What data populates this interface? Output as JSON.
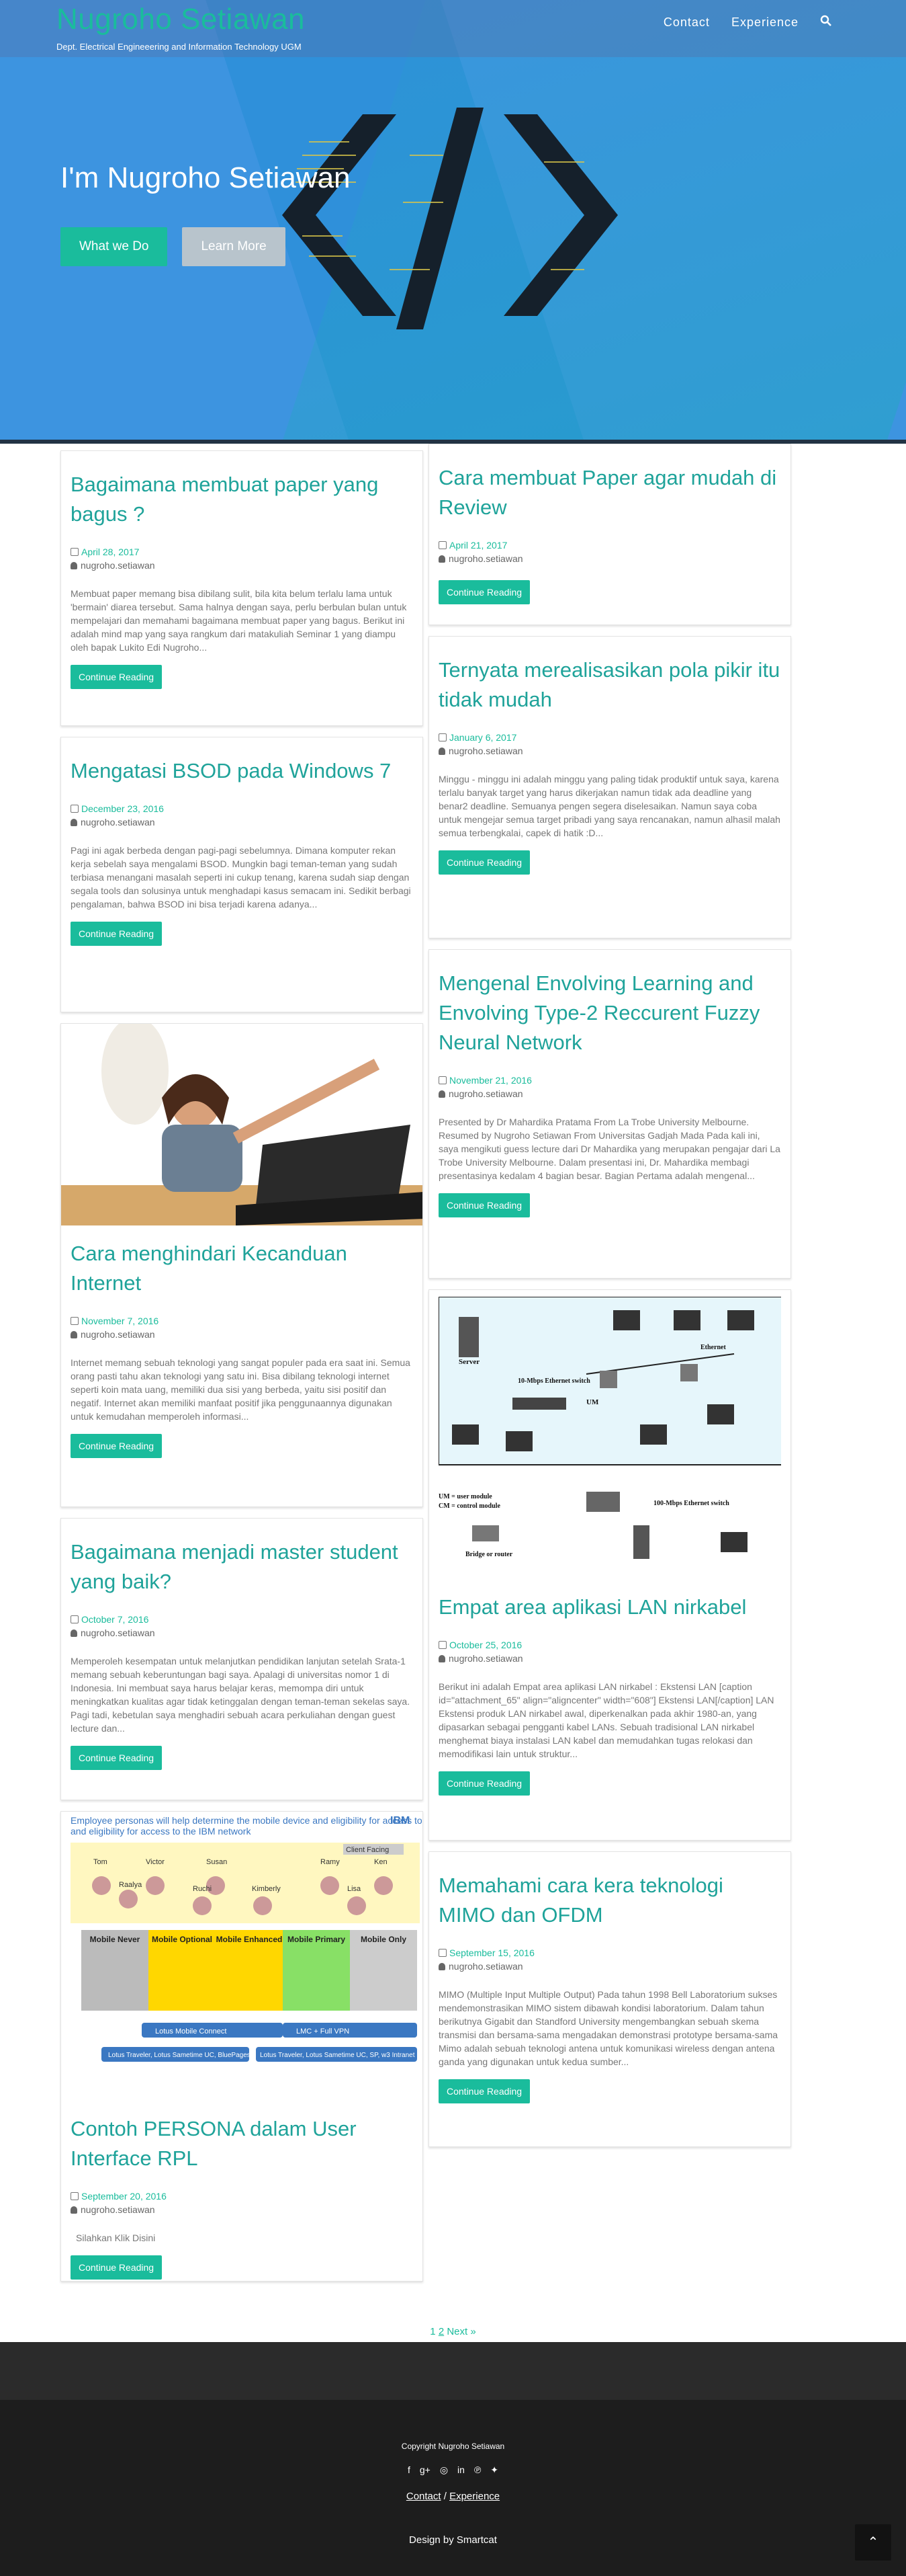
{
  "header": {
    "brand": "Nugroho Setiawan",
    "tagline": "Dept. Electrical Engineeering and Information Technology UGM",
    "nav": [
      "Contact",
      "Experience"
    ],
    "search_icon": "search-icon"
  },
  "hero": {
    "title": "I'm Nugroho Setiawan",
    "btn_primary": "What we Do",
    "btn_secondary": "Learn More"
  },
  "posts_left": [
    {
      "title": "Bagaimana membuat paper yang bagus ?",
      "date": "April 28, 2017",
      "author": "nugroho.setiawan",
      "excerpt": "Membuat paper memang bisa dibilang sulit, bila kita belum terlalu lama untuk 'bermain' diarea tersebut. Sama halnya dengan saya, perlu berbulan bulan untuk mempelajari dan memahami bagaimana membuat paper yang bagus. Berikut ini adalah mind map yang saya rangkum dari matakuliah Seminar 1 yang diampu oleh bapak Lukito Edi Nugroho...",
      "button": "Continue Reading"
    },
    {
      "title": "Mengatasi BSOD pada Windows 7",
      "date": "December 23, 2016",
      "author": "nugroho.setiawan",
      "excerpt": "Pagi ini agak berbeda dengan pagi-pagi sebelumnya. Dimana komputer rekan kerja sebelah saya mengalami BSOD. Mungkin bagi teman-teman yang sudah terbiasa menangani masalah seperti ini cukup tenang, karena sudah siap dengan segala tools dan solusinya untuk menghadapi kasus semacam ini. Sedikit berbagi pengalaman, bahwa BSOD ini bisa terjadi karena adanya...",
      "button": "Continue Reading"
    },
    {
      "title": "Cara menghindari Kecanduan Internet",
      "date": "November 7, 2016",
      "author": "nugroho.setiawan",
      "excerpt": "Internet memang sebuah teknologi yang sangat populer pada era saat ini. Semua orang pasti tahu akan teknologi yang satu ini. Bisa dibilang teknologi internet seperti koin mata uang, memiliki dua sisi yang berbeda, yaitu sisi positif dan negatif. Internet akan memiliki manfaat positif jika penggunaannya digunakan untuk kemudahan memperoleh informasi...",
      "button": "Continue Reading"
    },
    {
      "title": "Bagaimana menjadi master student yang baik?",
      "date": "October 7, 2016",
      "author": "nugroho.setiawan",
      "excerpt": "Memperoleh kesempatan untuk melanjutkan pendidikan lanjutan setelah Srata-1 memang sebuah keberuntungan bagi saya. Apalagi di universitas nomor 1 di Indonesia. Ini membuat saya harus belajar keras, memompa diri untuk meningkatkan kualitas agar tidak ketinggalan dengan teman-teman sekelas saya. Pagi tadi, kebetulan saya menghadiri sebuah acara perkuliahan dengan guest lecture dan...",
      "button": "Continue Reading"
    },
    {
      "title": "Contoh PERSONA dalam User Interface RPL",
      "date": "September 20, 2016",
      "author": "nugroho.setiawan",
      "excerpt": "Silahkan Klik Disini",
      "button": "Continue Reading"
    }
  ],
  "posts_right": [
    {
      "title": "Cara membuat Paper agar mudah di Review",
      "date": "April 21, 2017",
      "author": "nugroho.setiawan",
      "excerpt": "",
      "button": "Continue Reading"
    },
    {
      "title": "Ternyata merealisasikan pola pikir itu tidak mudah",
      "date": "January 6, 2017",
      "author": "nugroho.setiawan",
      "excerpt": "Minggu - minggu ini adalah minggu yang paling tidak produktif untuk saya, karena terlalu banyak target yang harus dikerjakan namun tidak ada deadline yang benar2 deadline. Semuanya pengen segera diselesaikan. Namun saya coba untuk mengejar semua target pribadi yang saya rencanakan, namun alhasil malah semua terbengkalai, capek di hatik :D...",
      "button": "Continue Reading"
    },
    {
      "title": "Mengenal Envolving Learning and Envolving Type-2 Reccurent Fuzzy Neural Network",
      "date": "November 21, 2016",
      "author": "nugroho.setiawan",
      "excerpt": "Presented by Dr Mahardika Pratama From La Trobe University Melbourne. Resumed by Nugroho Setiawan From Universitas Gadjah Mada Pada kali ini, saya mengikuti guess lecture dari Dr Mahardika yang merupakan pengajar dari La Trobe University Melbourne. Dalam presentasi ini, Dr. Mahardika membagi presentasinya kedalam 4 bagian besar. Bagian Pertama adalah mengenal...",
      "button": "Continue Reading"
    },
    {
      "title": "Empat area aplikasi LAN nirkabel",
      "date": "October 25, 2016",
      "author": "nugroho.setiawan",
      "excerpt": "Berikut ini adalah Empat area aplikasi LAN nirkabel : Ekstensi LAN [caption id=\"attachment_65\" align=\"aligncenter\" width=\"608\"] Ekstensi LAN[/caption] LAN Ekstensi produk LAN nirkabel awal, diperkenalkan pada akhir 1980-an, yang dipasarkan sebagai pengganti kabel LANs. Sebuah tradisional LAN nirkabel menghemat biaya instalasi LAN kabel dan memudahkan tugas relokasi dan memodifikasi lain untuk struktur...",
      "button": "Continue Reading"
    },
    {
      "title": "Memahami cara kera teknologi MIMO dan OFDM",
      "date": "September 15, 2016",
      "author": "nugroho.setiawan",
      "excerpt": "MIMO (Multiple Input Multiple Output) Pada tahun 1998 Bell Laboratorium sukses mendemonstrasikan MIMO sistem dibawah kondisi laboratorium. Dalam tahun berikutnya Gigabit dan Standford University mengembangkan sebuah skema transmisi dan bersama-sama mengadakan demonstrasi prototype bersama-sama Mimo adalah sebuah teknologi antena untuk komunikasi wireless dengan antena ganda yang digunakan untuk kedua sumber...",
      "button": "Continue Reading"
    }
  ],
  "network_diagram": {
    "server": "Server",
    "hub1": "10-Mbps Ethernet switch",
    "ethernet": "Ethernet",
    "um": "UM",
    "legend1": "UM = user module",
    "legend2": "CM = control module",
    "hub2": "100-Mbps Ethernet switch",
    "router": "Bridge or router"
  },
  "persona_chart": {
    "title": "Employee personas will help determine the mobile device and eligibility for access to the IBM network",
    "brand": "IBM",
    "cols": [
      "Mobile Never",
      "Mobile Optional",
      "Mobile Enhanced",
      "Mobile Primary",
      "Mobile Only"
    ],
    "personas": [
      "Tom",
      "Victor",
      "Raalya",
      "Susan",
      "Ruchi",
      "Kimberly",
      "Ramy",
      "Ken",
      "Lisa"
    ],
    "client_facing": "Client Facing",
    "bar1": "Lotus Mobile Connect",
    "bar2": "LMC + Full VPN",
    "bar3": "Lotus Traveler, Lotus Sametime UC, BluePages",
    "bar4": "Lotus Traveler, Lotus Sametime UC, SP, w3 Intranet"
  },
  "pagination": {
    "p1": "1",
    "p2": "2",
    "next": "Next »"
  },
  "footer": {
    "copyright": "Copyright Nugroho Setiawan",
    "social": [
      "facebook-icon",
      "google-plus-icon",
      "instagram-icon",
      "linkedin-icon",
      "pinterest-icon",
      "twitter-icon"
    ],
    "link1": "Contact",
    "sep": "/",
    "link2": "Experience",
    "design": "Design by Smartcat"
  }
}
